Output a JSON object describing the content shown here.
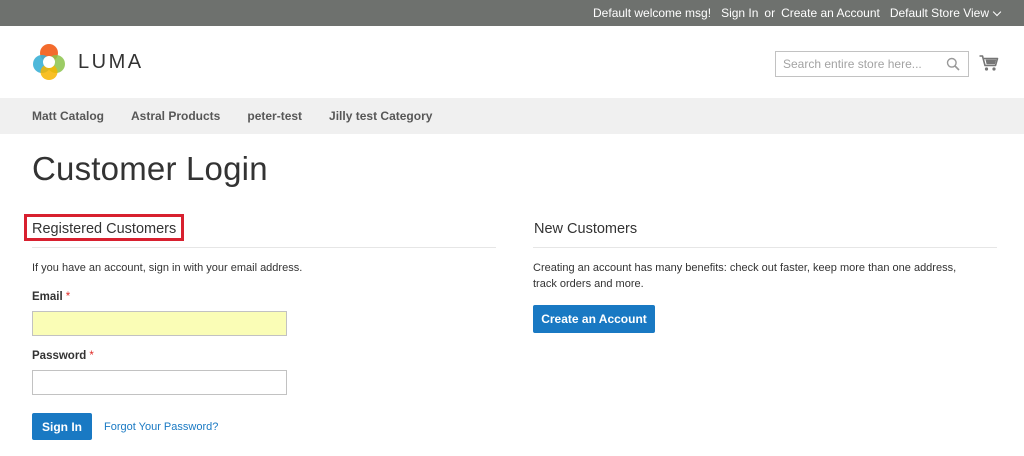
{
  "topbar": {
    "welcome": "Default welcome msg!",
    "sign_in": "Sign In",
    "or": "or",
    "create_account": "Create an Account",
    "store_view": "Default Store View"
  },
  "header": {
    "logo_text": "LUMA",
    "search_placeholder": "Search entire store here...",
    "search_icon": "search-icon",
    "cart_icon": "cart-icon"
  },
  "nav": {
    "items": [
      {
        "label": "Matt Catalog"
      },
      {
        "label": "Astral Products"
      },
      {
        "label": "peter-test"
      },
      {
        "label": "Jilly test Category"
      }
    ]
  },
  "page": {
    "title": "Customer Login"
  },
  "registered": {
    "title": "Registered Customers",
    "note": "If you have an account, sign in with your email address.",
    "email_label": "Email",
    "email_value": "",
    "password_label": "Password",
    "password_value": "",
    "required_mark": "*",
    "sign_in_button": "Sign In",
    "forgot_link": "Forgot Your Password?"
  },
  "new_customers": {
    "title": "New Customers",
    "note": "Creating an account has many benefits: check out faster, keep more than one address, track orders and more.",
    "create_button": "Create an Account"
  },
  "colors": {
    "topbar_bg": "#6e716e",
    "nav_bg": "#f0f0f0",
    "primary": "#1979c3",
    "highlight": "#d8202f",
    "autofill": "#fafdb6"
  }
}
